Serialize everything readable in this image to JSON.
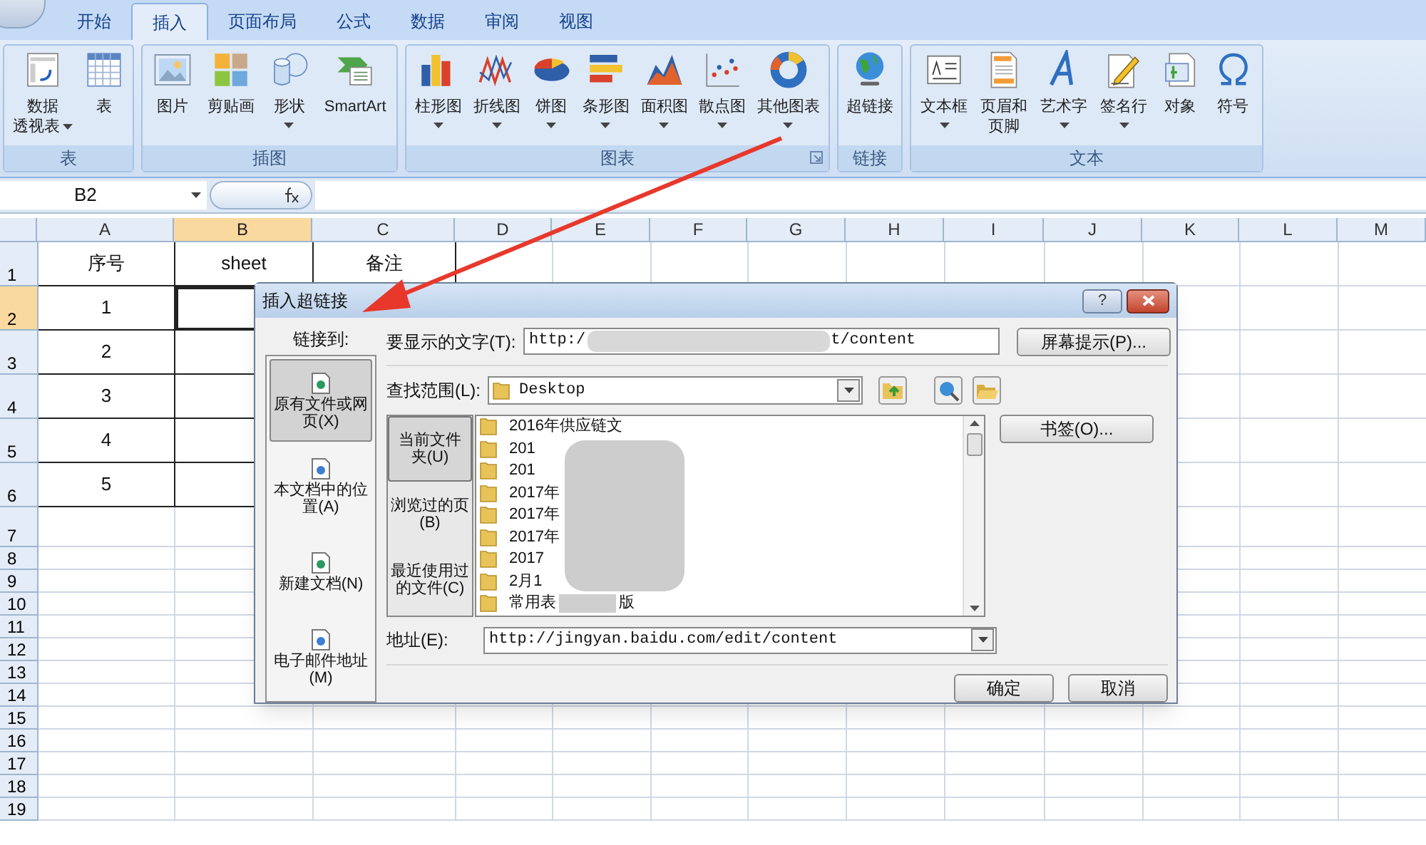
{
  "ribbon": {
    "tabs": [
      {
        "label": "开始",
        "selected": false
      },
      {
        "label": "插入",
        "selected": true
      },
      {
        "label": "页面布局",
        "selected": false
      },
      {
        "label": "公式",
        "selected": false
      },
      {
        "label": "数据",
        "selected": false
      },
      {
        "label": "审阅",
        "selected": false
      },
      {
        "label": "视图",
        "selected": false
      }
    ],
    "groups": [
      {
        "label": "表",
        "launcher": false,
        "items": [
          {
            "lines": [
              "数据",
              "透视表"
            ],
            "dropdown": true
          },
          {
            "lines": [
              "表"
            ],
            "dropdown": false
          }
        ]
      },
      {
        "label": "插图",
        "launcher": false,
        "items": [
          {
            "lines": [
              "图片"
            ],
            "dropdown": false
          },
          {
            "lines": [
              "剪贴画"
            ],
            "dropdown": false
          },
          {
            "lines": [
              "形状"
            ],
            "dropdown": true
          },
          {
            "lines": [
              "SmartArt"
            ],
            "dropdown": false
          }
        ]
      },
      {
        "label": "图表",
        "launcher": true,
        "items": [
          {
            "lines": [
              "柱形图"
            ],
            "dropdown": true
          },
          {
            "lines": [
              "折线图"
            ],
            "dropdown": true
          },
          {
            "lines": [
              "饼图"
            ],
            "dropdown": true
          },
          {
            "lines": [
              "条形图"
            ],
            "dropdown": true
          },
          {
            "lines": [
              "面积图"
            ],
            "dropdown": true
          },
          {
            "lines": [
              "散点图"
            ],
            "dropdown": true
          },
          {
            "lines": [
              "其他图表"
            ],
            "dropdown": true
          }
        ]
      },
      {
        "label": "链接",
        "launcher": false,
        "items": [
          {
            "lines": [
              "超链接"
            ],
            "dropdown": false
          }
        ]
      },
      {
        "label": "文本",
        "launcher": false,
        "items": [
          {
            "lines": [
              "文本框"
            ],
            "dropdown": true
          },
          {
            "lines": [
              "页眉和",
              "页脚"
            ],
            "dropdown": false
          },
          {
            "lines": [
              "艺术字"
            ],
            "dropdown": true
          },
          {
            "lines": [
              "签名行"
            ],
            "dropdown": true
          },
          {
            "lines": [
              "对象"
            ],
            "dropdown": false
          },
          {
            "lines": [
              "符号"
            ],
            "dropdown": false
          }
        ]
      }
    ]
  },
  "formula_bar": {
    "name_box": "B2"
  },
  "sheet": {
    "columns": [
      {
        "label": "A",
        "selected": false
      },
      {
        "label": "B",
        "selected": true
      },
      {
        "label": "C",
        "selected": false
      },
      {
        "label": "D",
        "selected": false
      },
      {
        "label": "E",
        "selected": false
      },
      {
        "label": "F",
        "selected": false
      },
      {
        "label": "G",
        "selected": false
      },
      {
        "label": "H",
        "selected": false
      },
      {
        "label": "I",
        "selected": false
      },
      {
        "label": "J",
        "selected": false
      },
      {
        "label": "K",
        "selected": false
      },
      {
        "label": "L",
        "selected": false
      },
      {
        "label": "M",
        "selected": false
      }
    ],
    "rows": [
      {
        "label": "1",
        "selected": false,
        "cells": [
          {
            "text": "序号",
            "selected": false
          },
          {
            "text": "sheet",
            "selected": false
          },
          {
            "text": "备注",
            "selected": false
          }
        ]
      },
      {
        "label": "2",
        "selected": true,
        "cells": [
          {
            "text": "1",
            "selected": false
          },
          {
            "selected": true
          }
        ]
      },
      {
        "label": "3",
        "selected": false,
        "cells": [
          {
            "text": "2",
            "selected": false
          },
          {
            "selected": false
          }
        ]
      },
      {
        "label": "4",
        "selected": false,
        "cells": [
          {
            "text": "3",
            "selected": false
          },
          {
            "selected": false
          }
        ]
      },
      {
        "label": "5",
        "selected": false,
        "cells": [
          {
            "text": "4",
            "selected": false
          },
          {
            "selected": false
          }
        ]
      },
      {
        "label": "6",
        "selected": false,
        "cells": [
          {
            "text": "5",
            "selected": false
          },
          {
            "selected": false
          }
        ]
      },
      {
        "label": "7",
        "selected": false
      },
      {
        "label": "8",
        "selected": false
      },
      {
        "label": "9",
        "selected": false
      },
      {
        "label": "10",
        "selected": false
      },
      {
        "label": "11",
        "selected": false
      },
      {
        "label": "12",
        "selected": false
      },
      {
        "label": "13",
        "selected": false
      },
      {
        "label": "14",
        "selected": false
      },
      {
        "label": "15",
        "selected": false
      },
      {
        "label": "16",
        "selected": false
      },
      {
        "label": "17",
        "selected": false
      },
      {
        "label": "18",
        "selected": false
      },
      {
        "label": "19",
        "selected": false
      }
    ]
  },
  "dialog": {
    "title": "插入超链接",
    "help_button": "?",
    "link_to_label": "链接到:",
    "link_targets": [
      {
        "label": "原有文件或网页(X)",
        "selected": true
      },
      {
        "label": "本文档中的位置(A)",
        "selected": false
      },
      {
        "label": "新建文档(N)",
        "selected": false
      },
      {
        "label": "电子邮件地址(M)",
        "selected": false
      }
    ],
    "display_text": {
      "label": "要显示的文字(T):",
      "value_start": "http:/",
      "value_end": "t/content"
    },
    "screen_tip_button": "屏幕提示(P)...",
    "look_in": {
      "label": "查找范围(L):",
      "value": "Desktop"
    },
    "browse_tabs": [
      {
        "label": "当前文件夹(U)",
        "selected": true
      },
      {
        "label": "浏览过的页(B)",
        "selected": false
      },
      {
        "label": "最近使用过的文件(C)",
        "selected": false
      }
    ],
    "files": [
      {
        "name": "2016年供应链文"
      },
      {
        "name": "201"
      },
      {
        "name": "201"
      },
      {
        "name": "2017年"
      },
      {
        "name": "2017年"
      },
      {
        "name": "2017年"
      },
      {
        "name": "2017"
      },
      {
        "name": "2月1"
      },
      {
        "name": "常用表",
        "tail": "版"
      }
    ],
    "bookmark_button": "书签(O)...",
    "address": {
      "label": "地址(E):",
      "value": "http://jingyan.baidu.com/edit/content"
    },
    "ok_button": "确定",
    "cancel_button": "取消"
  }
}
